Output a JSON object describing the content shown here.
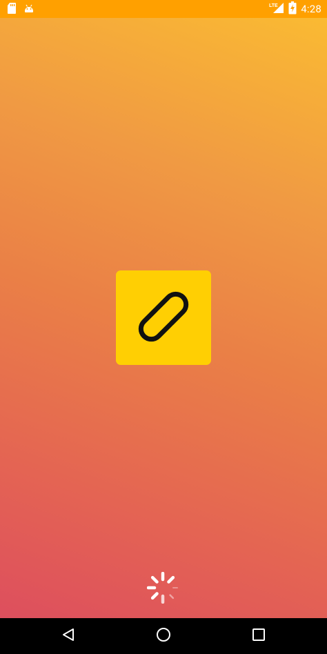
{
  "status_bar": {
    "time": "4:28",
    "network": "LTE",
    "icons": [
      "sd-card-icon",
      "android-icon",
      "lte-signal-icon",
      "battery-charging-icon"
    ]
  },
  "splash": {
    "logo_icon": "link-chain-icon",
    "logo_tile_color": "#ffcf03",
    "background_gradient": [
      "#fbbd31",
      "#ea8046",
      "#dc4a60"
    ],
    "loading_indicator": "spinner-icon"
  },
  "nav_bar": {
    "icons": [
      "back-icon",
      "home-icon",
      "recents-icon"
    ]
  }
}
